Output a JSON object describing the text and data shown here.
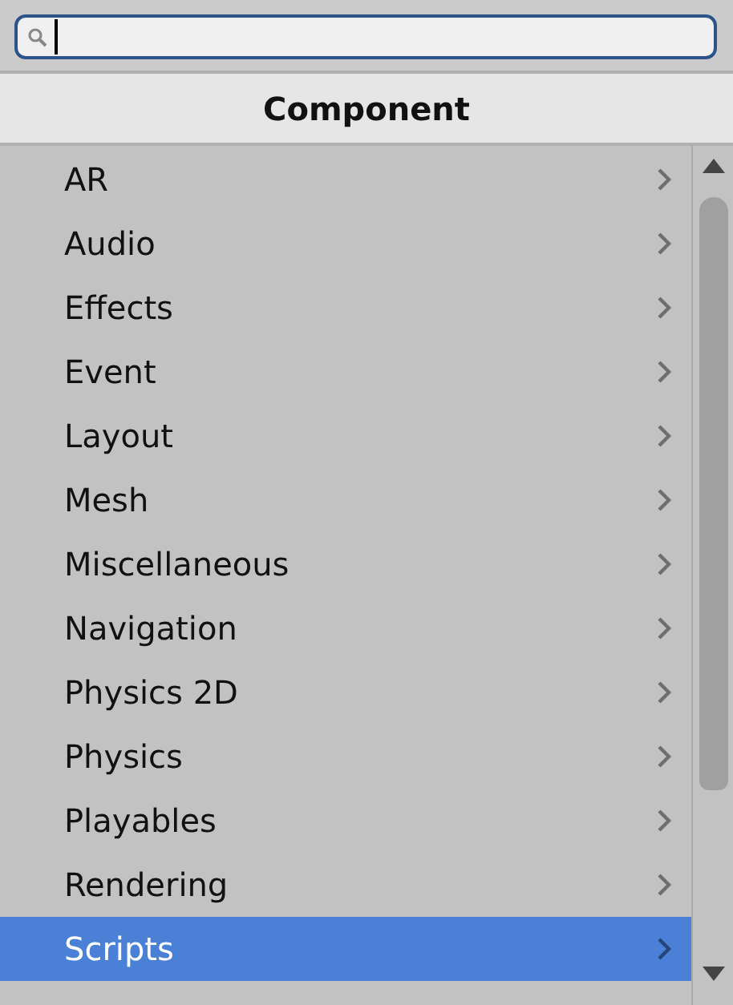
{
  "header": {
    "title": "Component"
  },
  "items": [
    {
      "label": "AR",
      "selected": false
    },
    {
      "label": "Audio",
      "selected": false
    },
    {
      "label": "Effects",
      "selected": false
    },
    {
      "label": "Event",
      "selected": false
    },
    {
      "label": "Layout",
      "selected": false
    },
    {
      "label": "Mesh",
      "selected": false
    },
    {
      "label": "Miscellaneous",
      "selected": false
    },
    {
      "label": "Navigation",
      "selected": false
    },
    {
      "label": "Physics 2D",
      "selected": false
    },
    {
      "label": "Physics",
      "selected": false
    },
    {
      "label": "Playables",
      "selected": false
    },
    {
      "label": "Rendering",
      "selected": false
    },
    {
      "label": "Scripts",
      "selected": true
    }
  ]
}
